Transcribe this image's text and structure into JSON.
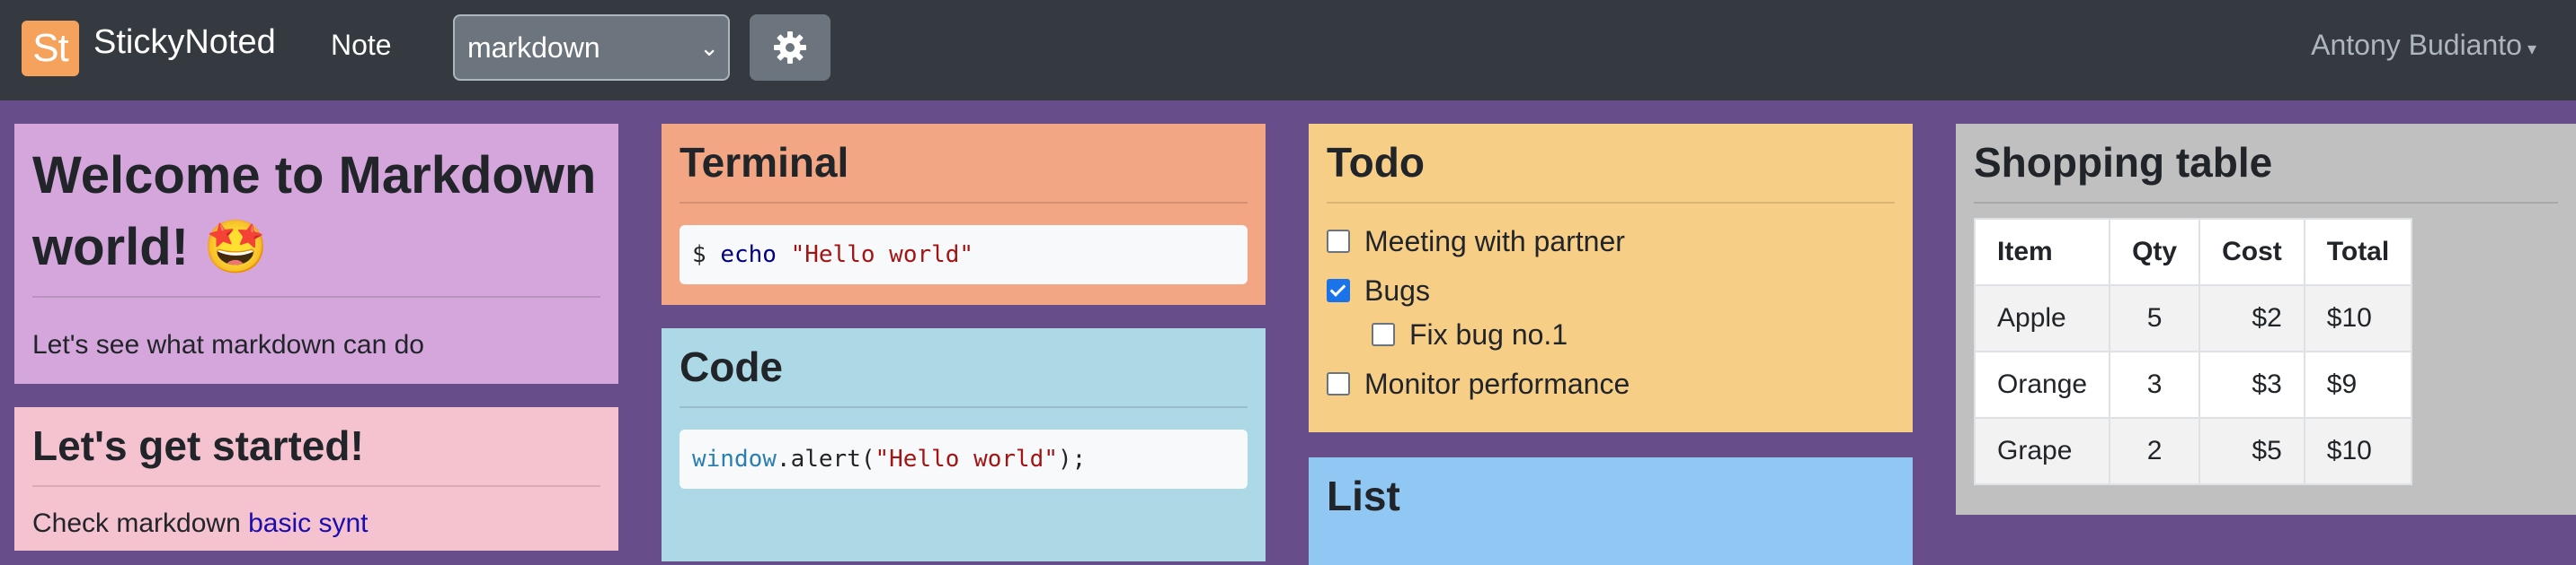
{
  "navbar": {
    "logo_text": "St",
    "brand": "StickyNoted",
    "note_link": "Note",
    "mode_select": "markdown",
    "settings_icon": "gear-icon",
    "user_name": "Antony Budianto"
  },
  "cards": {
    "welcome": {
      "title": "Welcome to Markdown world! 🤩",
      "body": "Let's see what markdown can do",
      "color": "#d4a6dc"
    },
    "get_started": {
      "title": "Let's get started!",
      "body_prefix": "Check markdown ",
      "body_link": "basic synt",
      "color": "#f5c2d0"
    },
    "terminal": {
      "title": "Terminal",
      "prompt": "$ ",
      "command": "echo",
      "argument": "\"Hello world\"",
      "color": "#f2a683"
    },
    "code": {
      "title": "Code",
      "object": "window",
      "method": ".alert(",
      "string": "\"Hello world\"",
      "end": ");",
      "color": "#add8e6"
    },
    "todo": {
      "title": "Todo",
      "color": "#f7ce86",
      "items": [
        {
          "label": "Meeting with partner",
          "checked": false
        },
        {
          "label": "Bugs",
          "checked": true
        },
        {
          "label": "Fix bug no.1",
          "checked": false
        },
        {
          "label": "Monitor performance",
          "checked": false
        }
      ]
    },
    "list": {
      "title": "List",
      "color": "#91c8f3"
    },
    "shopping": {
      "title": "Shopping table",
      "color": "#c0c0c0",
      "headers": [
        "Item",
        "Qty",
        "Cost",
        "Total"
      ],
      "rows": [
        [
          "Apple",
          "5",
          "$2",
          "$10"
        ],
        [
          "Orange",
          "3",
          "$3",
          "$9"
        ],
        [
          "Grape",
          "2",
          "$5",
          "$10"
        ]
      ]
    }
  }
}
